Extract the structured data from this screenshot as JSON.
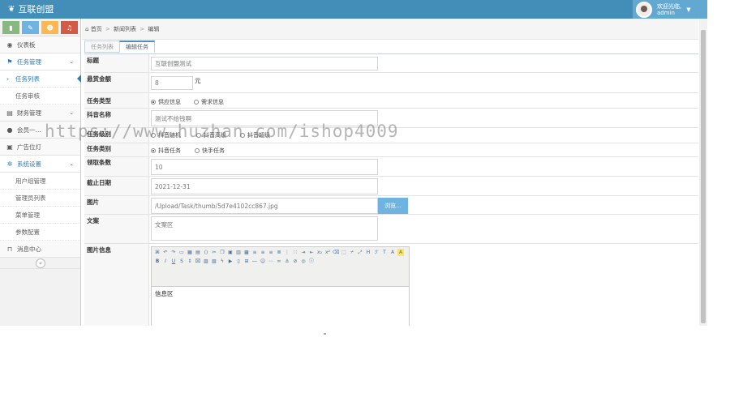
{
  "header": {
    "brand": "互联创盟",
    "greeting": "欢迎光临,",
    "username": "admin"
  },
  "sidebar": {
    "shortcut_colors": [
      "#87b87f",
      "#6fb3e0",
      "#ffb752",
      "#d15b47"
    ],
    "items": [
      {
        "label": "仪表板",
        "icon": "dashboard-icon"
      },
      {
        "label": "任务管理",
        "icon": "flag-icon"
      },
      {
        "label": "财务管理",
        "icon": "wallet-icon"
      },
      {
        "label": "会员一…",
        "icon": "user-icon"
      },
      {
        "label": "广告位灯",
        "icon": "picture-icon"
      },
      {
        "label": "系统设置",
        "icon": "gear-icon"
      },
      {
        "label": "消息中心",
        "icon": "bookmark-icon"
      }
    ],
    "task_sub": [
      "任务列表",
      "任务审核"
    ],
    "system_sub": [
      "用户组管理",
      "管理员列表",
      "菜单管理",
      "参数配置"
    ]
  },
  "breadcrumb": {
    "home": "首页",
    "list": "新闻列表",
    "current": "编辑"
  },
  "tabs": [
    "任务列表",
    "编辑任务"
  ],
  "form": {
    "title_label": "标题",
    "title_value": "互联创盟测试",
    "reward_label": "悬赏金额",
    "reward_value": "8",
    "reward_unit": "元",
    "type_label": "任务类型",
    "type_options": [
      "供应信息",
      "需求信息"
    ],
    "douyin_label": "抖音名称",
    "douyin_value": "测试不给钱啊",
    "level_label": "任务级别",
    "level_options": [
      "抖音随机",
      "抖音高级",
      "抖音超级"
    ],
    "category_label": "任务类别",
    "category_options": [
      "抖音任务",
      "快手任务"
    ],
    "count_label": "领取条数",
    "count_value": "10",
    "deadline_label": "截止日期",
    "deadline_value": "2021-12-31",
    "image_label": "图片",
    "image_value": "/Upload/Task/thumb/5d7e4102cc867.jpg",
    "browse_label": "浏览...",
    "copy_label": "文案",
    "copy_value": "文案区",
    "info_label": "图片信息",
    "info_value": "信息区"
  },
  "watermark": "https://www.huzhan.com/ishop4009"
}
